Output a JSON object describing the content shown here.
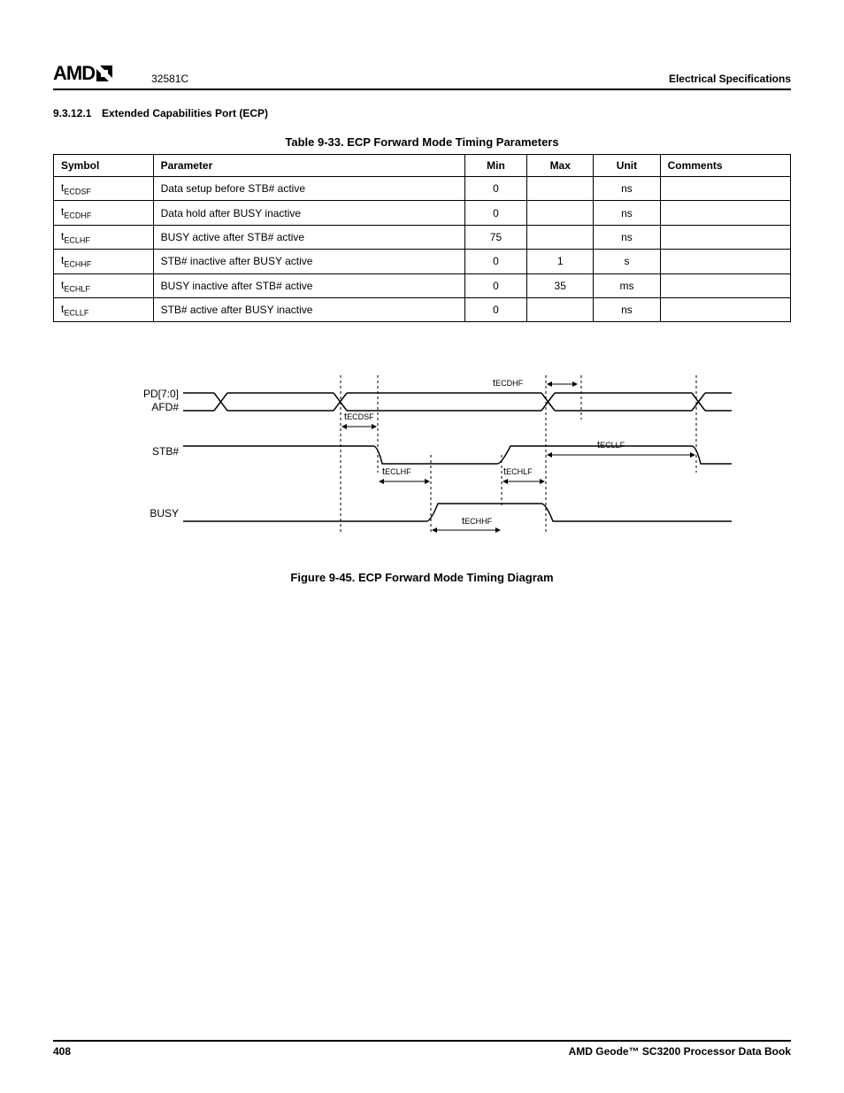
{
  "header": {
    "logo_text": "AMD",
    "doc_code": "32581C",
    "spec_title": "Electrical Specifications"
  },
  "section": {
    "number": "9.3.12.1",
    "title": "Extended Capabilities Port (ECP)"
  },
  "table": {
    "caption": "Table 9-33.  ECP Forward Mode Timing Parameters",
    "headers": [
      "Symbol",
      "Parameter",
      "Min",
      "Max",
      "Unit",
      "Comments"
    ],
    "rows": [
      {
        "sym_sub": "ECDSF",
        "param": "Data setup before STB# active",
        "min": "0",
        "max": "",
        "unit": "ns",
        "comments": ""
      },
      {
        "sym_sub": "ECDHF",
        "param": "Data hold after BUSY inactive",
        "min": "0",
        "max": "",
        "unit": "ns",
        "comments": ""
      },
      {
        "sym_sub": "ECLHF",
        "param": "BUSY active after STB# active",
        "min": "75",
        "max": "",
        "unit": "ns",
        "comments": ""
      },
      {
        "sym_sub": "ECHHF",
        "param": "STB# inactive after BUSY active",
        "min": "0",
        "max": "1",
        "unit": "s",
        "comments": ""
      },
      {
        "sym_sub": "ECHLF",
        "param": "BUSY inactive after STB# active",
        "min": "0",
        "max": "35",
        "unit": "ms",
        "comments": ""
      },
      {
        "sym_sub": "ECLLF",
        "param": "STB# active after BUSY inactive",
        "min": "0",
        "max": "",
        "unit": "ns",
        "comments": ""
      }
    ]
  },
  "figure": {
    "caption": "Figure 9-45.  ECP Forward Mode Timing Diagram",
    "signals": {
      "pd": "PD[7:0]",
      "afd": "AFD#",
      "stb": "STB#",
      "busy": "BUSY"
    },
    "labels": {
      "ecdhf": "ECDHF",
      "ecdsf": "ECDSF",
      "ecllf": "ECLLF",
      "eclhf": "ECLHF",
      "echlf": "ECHLF",
      "echhf": "ECHHF"
    }
  },
  "footer": {
    "page": "408",
    "book": "AMD Geode™ SC3200 Processor Data Book"
  }
}
